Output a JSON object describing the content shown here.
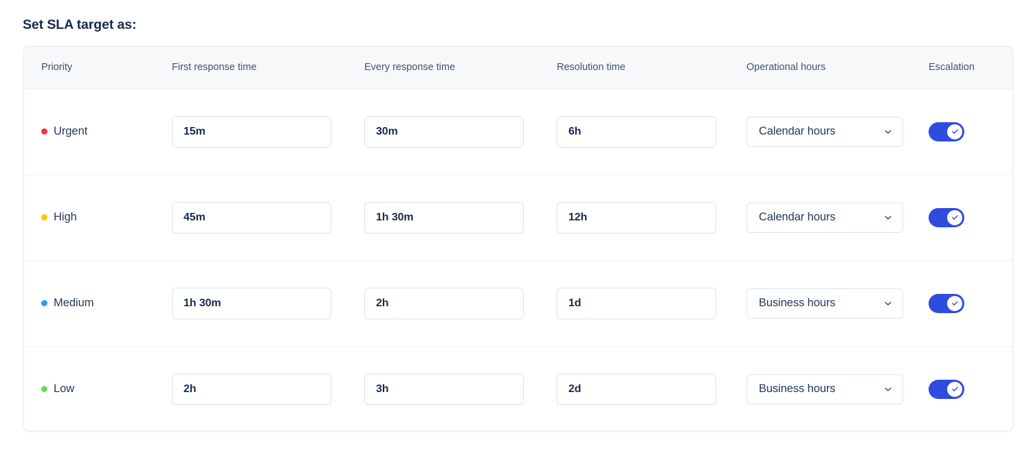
{
  "page": {
    "title": "Set SLA target as:"
  },
  "table": {
    "columns": [
      {
        "key": "priority",
        "label": "Priority"
      },
      {
        "key": "first",
        "label": "First response time"
      },
      {
        "key": "every",
        "label": "Every response time"
      },
      {
        "key": "resolution",
        "label": "Resolution time"
      },
      {
        "key": "operational",
        "label": "Operational hours"
      },
      {
        "key": "escalation",
        "label": "Escalation"
      }
    ],
    "rows": [
      {
        "priority": "Urgent",
        "priority_color": "#f5333f",
        "first_response_time": "15m",
        "every_response_time": "30m",
        "resolution_time": "6h",
        "operational_hours": "Calendar hours",
        "escalation_enabled": "on"
      },
      {
        "priority": "High",
        "priority_color": "#ffc400",
        "first_response_time": "45m",
        "every_response_time": "1h 30m",
        "resolution_time": "12h",
        "operational_hours": "Calendar hours",
        "escalation_enabled": "on"
      },
      {
        "priority": "Medium",
        "priority_color": "#2f9bff",
        "first_response_time": "1h 30m",
        "every_response_time": "2h",
        "resolution_time": "1d",
        "operational_hours": "Business hours",
        "escalation_enabled": "on"
      },
      {
        "priority": "Low",
        "priority_color": "#6fd649",
        "first_response_time": "2h",
        "every_response_time": "3h",
        "resolution_time": "2d",
        "operational_hours": "Business hours",
        "escalation_enabled": "on"
      }
    ]
  },
  "icons": {
    "chevron": "chevron-down-icon",
    "check": "check-icon"
  },
  "colors": {
    "accent": "#2f4ce0",
    "header_background": "#f7f8fa",
    "border": "#dde3ed",
    "text": "#172b4d"
  }
}
